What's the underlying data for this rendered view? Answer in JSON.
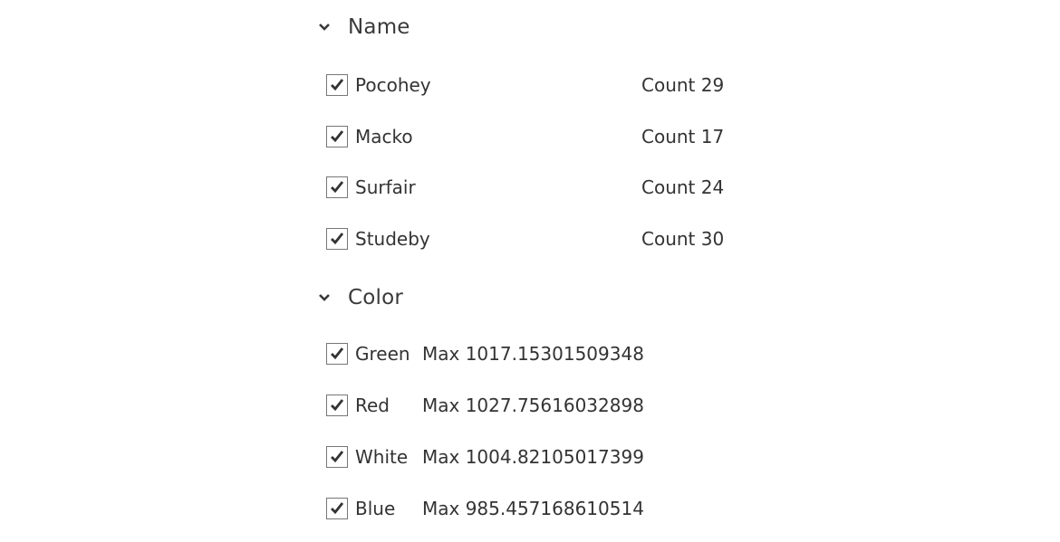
{
  "groups": [
    {
      "title": "Name",
      "expanded": true,
      "icon": "chevron-down-icon",
      "items": [
        {
          "label": "Pocohey",
          "checked": true,
          "aggregate": "Count 29"
        },
        {
          "label": "Macko",
          "checked": true,
          "aggregate": "Count 17"
        },
        {
          "label": "Surfair",
          "checked": true,
          "aggregate": "Count 24"
        },
        {
          "label": "Studeby",
          "checked": true,
          "aggregate": "Count 30"
        }
      ]
    },
    {
      "title": "Color",
      "expanded": true,
      "icon": "chevron-down-icon",
      "items": [
        {
          "label": "Green",
          "checked": true,
          "aggregate": "Max 1017.15301509348"
        },
        {
          "label": "Red",
          "checked": true,
          "aggregate": "Max 1027.75616032898"
        },
        {
          "label": "White",
          "checked": true,
          "aggregate": "Max 1004.82105017399"
        },
        {
          "label": "Blue",
          "checked": true,
          "aggregate": "Max 985.457168610514"
        }
      ]
    }
  ]
}
